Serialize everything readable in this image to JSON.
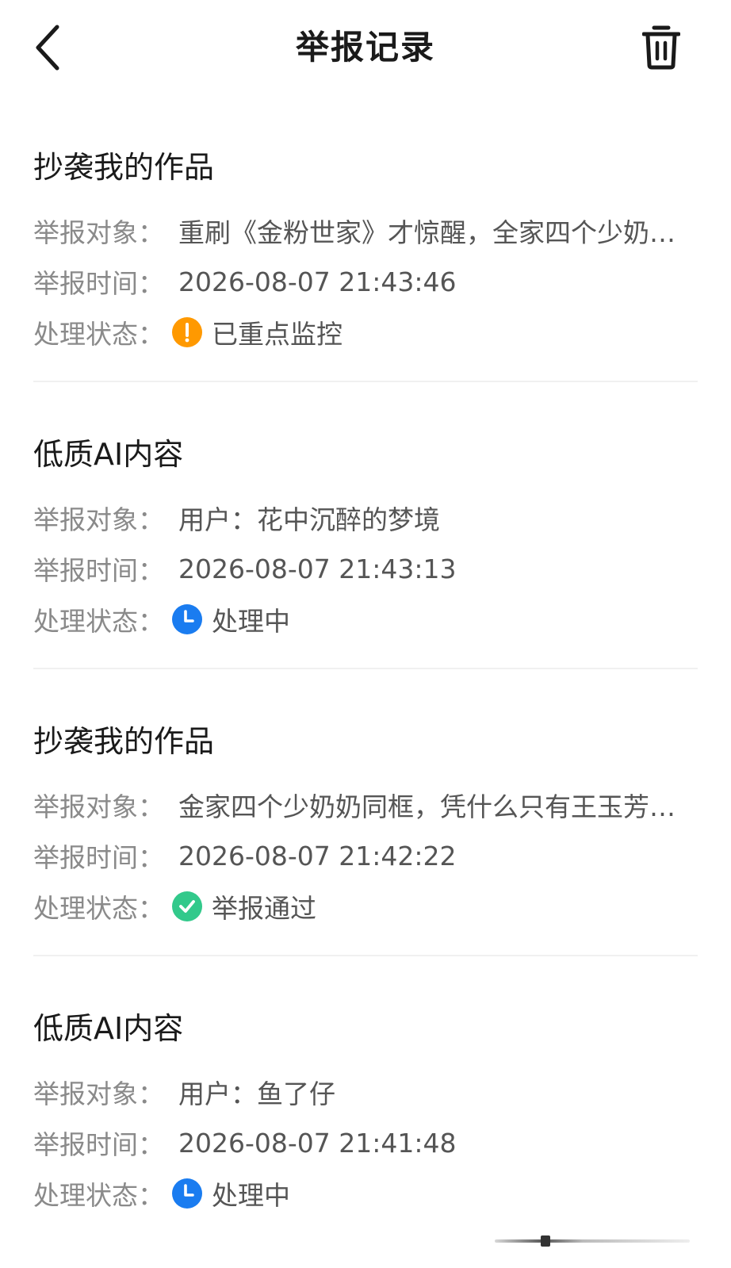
{
  "header": {
    "title": "举报记录",
    "back_icon": "chevron-left-icon",
    "trash_icon": "trash-icon"
  },
  "labels": {
    "target": "举报对象：",
    "time": "举报时间：",
    "status": "处理状态："
  },
  "colors": {
    "monitor": "#FF9900",
    "processing": "#1A7CF0",
    "approved": "#32C98B"
  },
  "records": [
    {
      "title": "抄袭我的作品",
      "target": "重刷《金粉世家》才惊醒，全家四个少奶奶同框，凭什么只有王玉芳…",
      "time": "2026-08-07 21:43:46",
      "status": "已重点监控",
      "status_icon": "exclamation-circle-icon"
    },
    {
      "title": "低质AI内容",
      "target": "用户：花中沉醉的梦境",
      "time": "2026-08-07 21:43:13",
      "status": "处理中",
      "status_icon": "clock-icon"
    },
    {
      "title": "抄袭我的作品",
      "target": "金家四个少奶奶同框，凭什么只有王玉芳被人记住…",
      "time": "2026-08-07 21:42:22",
      "status": "举报通过",
      "status_icon": "check-circle-icon"
    },
    {
      "title": "低质AI内容",
      "target": "用户：鱼了仔",
      "time": "2026-08-07 21:41:48",
      "status": "处理中",
      "status_icon": "clock-icon"
    }
  ]
}
